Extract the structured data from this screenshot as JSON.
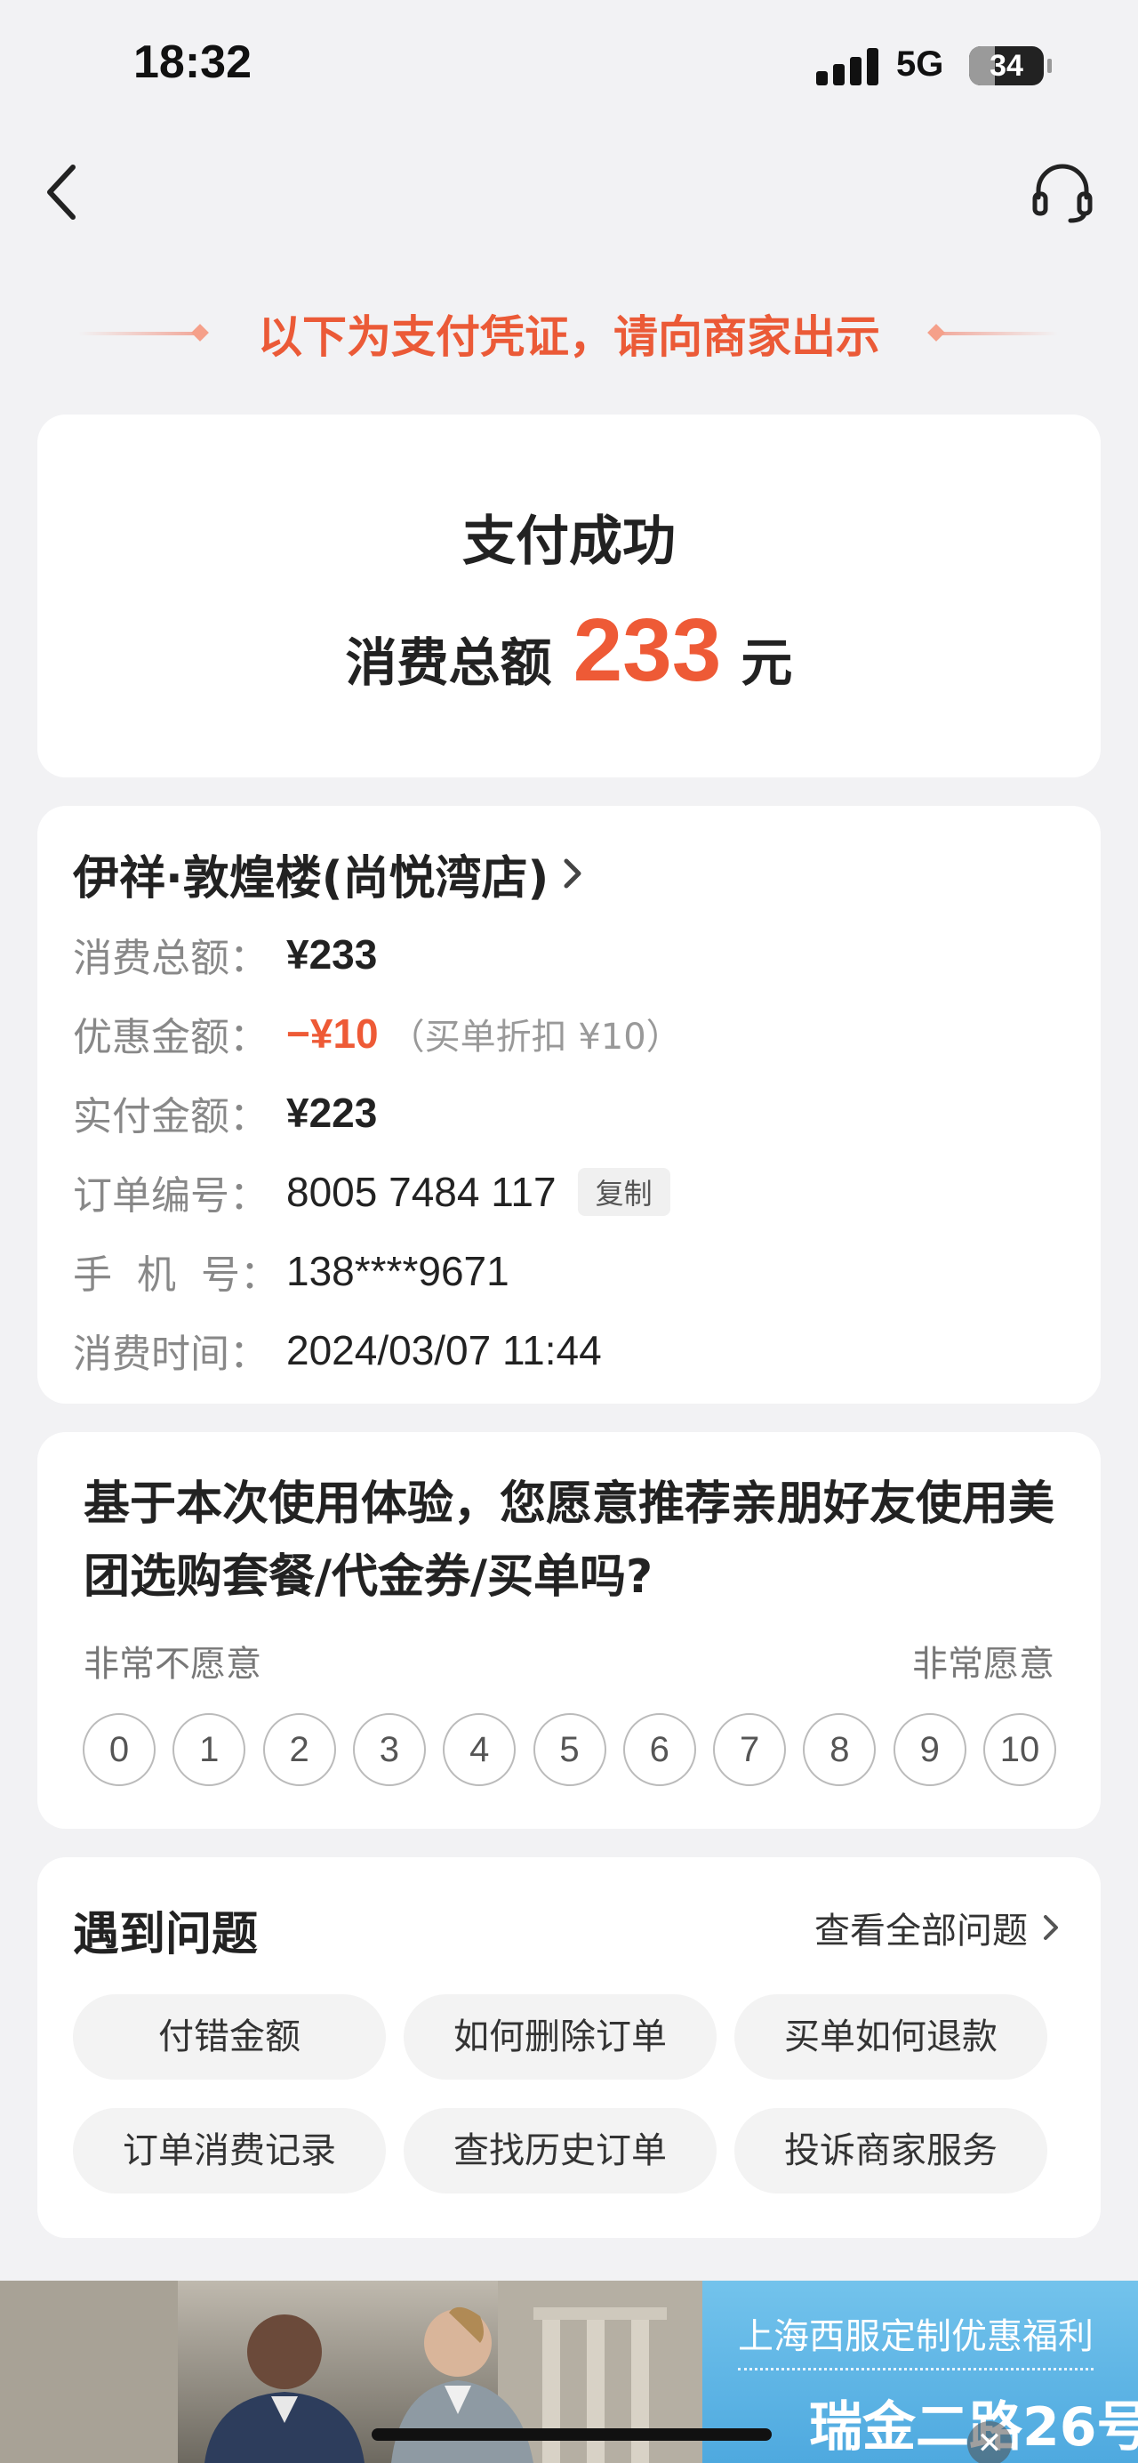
{
  "status_bar": {
    "time": "18:32",
    "network": "5G",
    "battery": "34",
    "battery_fraction": 0.34
  },
  "nav": {
    "back_icon": "chevron-left-icon",
    "service_icon": "headset-icon"
  },
  "voucher_notice": "以下为支付凭证，请向商家出示",
  "payment": {
    "status": "支付成功",
    "total_label": "消费总额",
    "total_amount": "233",
    "unit": "元"
  },
  "order": {
    "merchant_name": "伊祥·敦煌楼(尚悦湾店)",
    "details": [
      {
        "label": "消费总额：",
        "value": "¥233"
      },
      {
        "label": "优惠金额：",
        "value": "−¥10",
        "note": "（买单折扣 ¥10）"
      },
      {
        "label": "实付金额：",
        "value": "¥223"
      },
      {
        "label": "订单编号：",
        "value": "8005 7484 117",
        "action": "复制"
      },
      {
        "label": "手  机  号：",
        "value": "138****9671"
      },
      {
        "label": "消费时间：",
        "value": "2024/03/07 11:44"
      }
    ]
  },
  "survey": {
    "question": "基于本次使用体验，您愿意推荐亲朋好友使用美团选购套餐/代金券/买单吗?",
    "low_label": "非常不愿意",
    "high_label": "非常愿意",
    "scores": [
      "0",
      "1",
      "2",
      "3",
      "4",
      "5",
      "6",
      "7",
      "8",
      "9",
      "10"
    ]
  },
  "problems": {
    "title": "遇到问题",
    "view_all": "查看全部问题",
    "chips": [
      "付错金额",
      "如何删除订单",
      "买单如何退款",
      "订单消费记录",
      "查找历史订单",
      "投诉商家服务"
    ]
  },
  "ad": {
    "title": "上海西服定制优惠福利",
    "subtitle": "瑞金二路26号",
    "close_icon": "close-icon"
  },
  "colors": {
    "accent": "#ee5a36",
    "background": "#f2f2f4",
    "card": "#ffffff",
    "ad_blue": "#5ab4e6"
  }
}
